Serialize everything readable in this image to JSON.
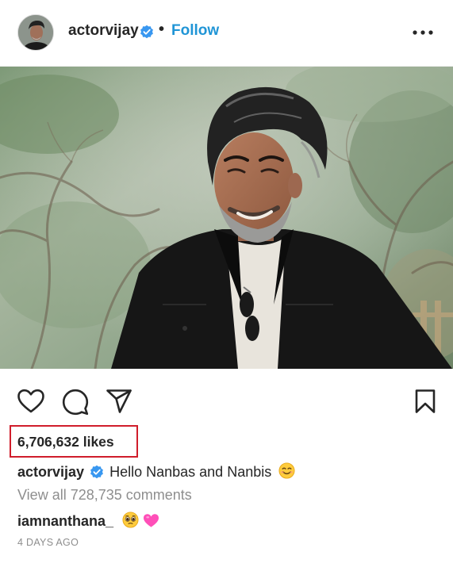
{
  "post": {
    "author": "actorvijay",
    "separator": "•",
    "follow_label": "Follow",
    "likes_text": "6,706,632 likes",
    "caption_user": "actorvijay",
    "caption_text": "Hello Nanbas and Nanbis",
    "view_comments_label": "View all 728,735 comments",
    "comment_user": "iamnanthana_",
    "timestamp": "4 DAYS AGO"
  },
  "icons": {
    "more": "more-options-icon",
    "like": "heart-icon",
    "comment": "comment-bubble-icon",
    "share": "paper-plane-icon",
    "save": "bookmark-icon",
    "verified": "verified-badge-icon",
    "caption_emoji": "smiling-face-emoji",
    "comment_emojis": [
      "pleading-face-emoji",
      "pink-heart-emoji"
    ]
  },
  "colors": {
    "follow_blue": "#2095d6",
    "verified_blue": "#3897f0",
    "highlight_red": "#d01d2b",
    "muted_gray": "#8e8e8e",
    "text": "#262626"
  }
}
